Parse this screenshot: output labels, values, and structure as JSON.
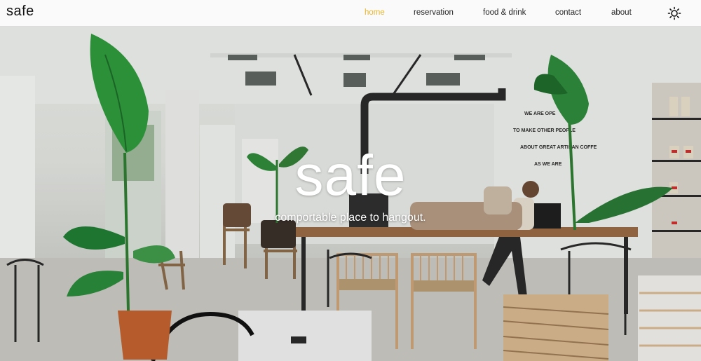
{
  "brand": {
    "logo_text": "safe"
  },
  "nav": {
    "items": [
      {
        "label": "home",
        "active": true
      },
      {
        "label": "reservation",
        "active": false
      },
      {
        "label": "food & drink",
        "active": false
      },
      {
        "label": "contact",
        "active": false
      },
      {
        "label": "about",
        "active": false
      }
    ],
    "theme_toggle_icon": "sun-icon",
    "active_color": "#e9b72c"
  },
  "hero": {
    "title": "safe",
    "subtitle": "comportable place to hangout.",
    "background": "cafe-interior-photo",
    "wall_text": [
      "WE ARE OPE",
      "TO MAKE OTHER PEOPLE",
      "ABOUT GREAT ARTISAN COFFE",
      "AS WE ARE"
    ]
  }
}
